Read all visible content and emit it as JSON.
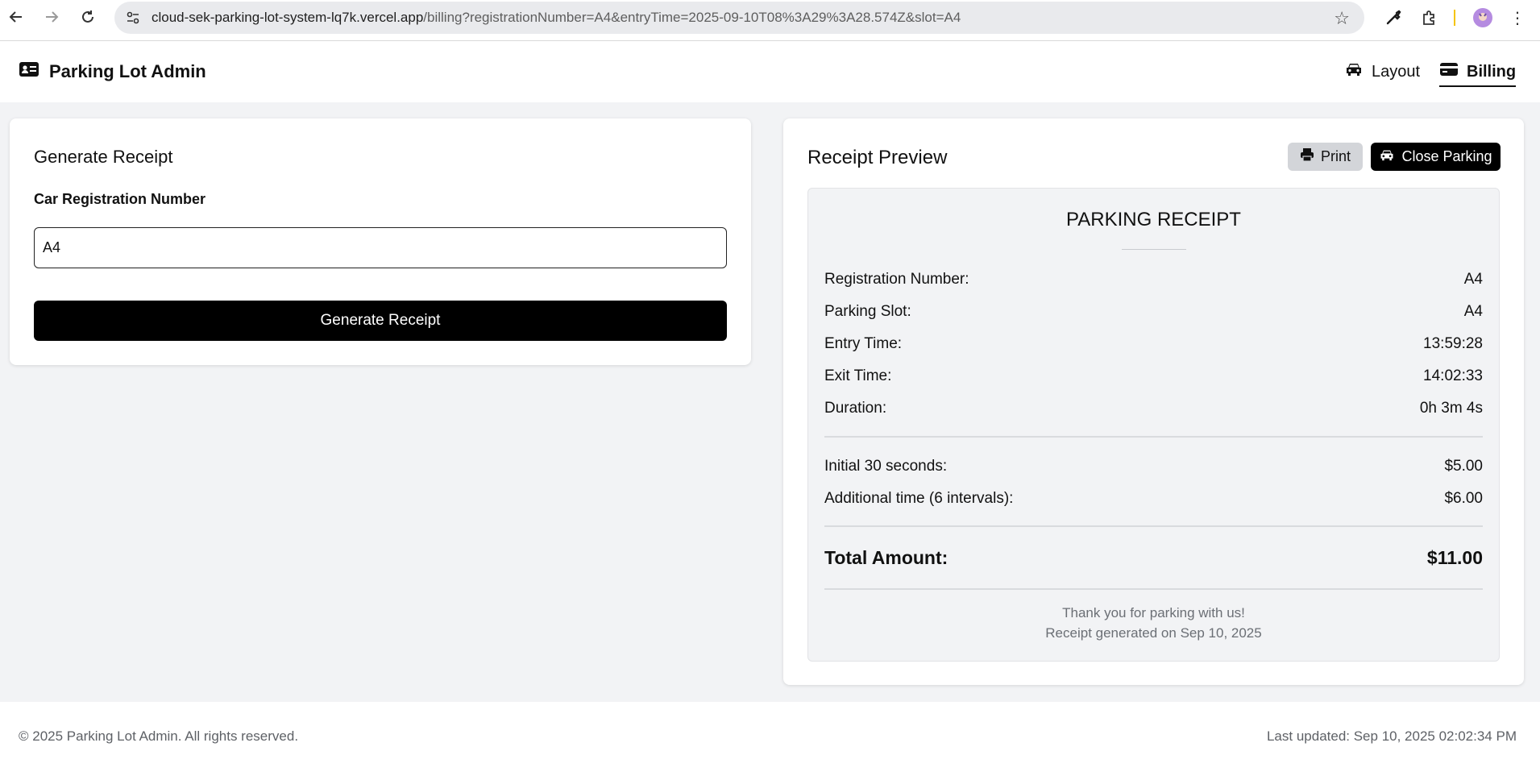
{
  "browser": {
    "url_host": "cloud-sek-parking-lot-system-lq7k.vercel.app",
    "url_path": "/billing?registrationNumber=A4&entryTime=2025-09-10T08%3A29%3A28.574Z&slot=A4",
    "icons": [
      "back-icon",
      "forward-icon",
      "reload-icon",
      "site-info-icon",
      "star-icon",
      "eyedropper-icon",
      "extensions-icon",
      "profile-avatar-icon",
      "more-icon"
    ],
    "profile_color": "#b58be0"
  },
  "header": {
    "brand": "Parking Lot Admin",
    "nav": [
      {
        "label": "Layout",
        "icon": "car-icon"
      },
      {
        "label": "Billing",
        "icon": "credit-card-icon",
        "active": true
      }
    ]
  },
  "generate": {
    "title": "Generate Receipt",
    "field_label": "Car Registration Number",
    "field_value": "A4",
    "button_label": "Generate Receipt"
  },
  "preview": {
    "title": "Receipt Preview",
    "print_label": "Print",
    "close_label": "Close Parking",
    "receipt": {
      "heading": "PARKING RECEIPT",
      "details": [
        {
          "label": "Registration Number:",
          "value": "A4"
        },
        {
          "label": "Parking Slot:",
          "value": "A4"
        },
        {
          "label": "Entry Time:",
          "value": "13:59:28"
        },
        {
          "label": "Exit Time:",
          "value": "14:02:33"
        },
        {
          "label": "Duration:",
          "value": "0h 3m 4s"
        }
      ],
      "charges": [
        {
          "label": "Initial 30 seconds:",
          "value": "$5.00"
        },
        {
          "label": "Additional time (6 intervals):",
          "value": "$6.00"
        }
      ],
      "total_label": "Total Amount:",
      "total_value": "$11.00",
      "thanks": "Thank you for parking with us!",
      "generated": "Receipt generated on Sep 10, 2025"
    }
  },
  "footer": {
    "copyright": "© 2025 Parking Lot Admin. All rights reserved.",
    "last_updated": "Last updated: Sep 10, 2025 02:02:34 PM"
  },
  "colors": {
    "page_bg": "#f2f3f5",
    "primary": "#000000",
    "secondary_button": "#d3d5d9",
    "muted_text": "#6b6f75"
  }
}
